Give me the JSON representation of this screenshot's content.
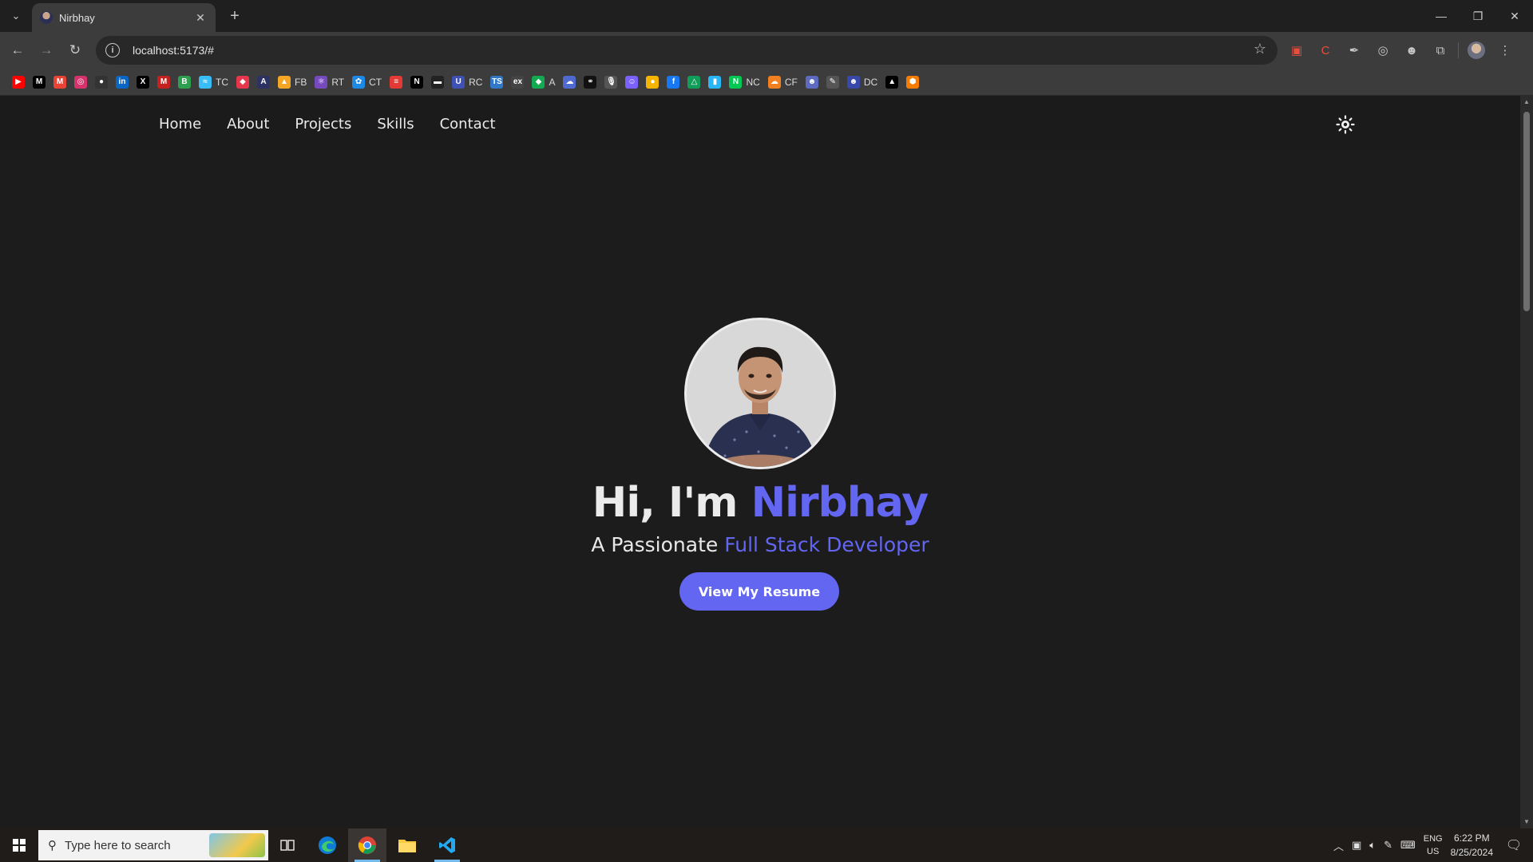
{
  "browser": {
    "tab_title": "Nirbhay",
    "url": "localhost:5173/#",
    "window_controls": {
      "minimize": "—",
      "restore": "❐",
      "close": "✕"
    },
    "bookmarks": [
      {
        "icon": "youtube-icon",
        "label": "",
        "color": "#ff0000",
        "glyph": "▶"
      },
      {
        "icon": "medium-icon",
        "label": "",
        "color": "#000000",
        "glyph": "M"
      },
      {
        "icon": "gmail-icon",
        "label": "",
        "color": "#ea4335",
        "glyph": "M"
      },
      {
        "icon": "chat-icon",
        "label": "",
        "color": "#d6336c",
        "glyph": "◎"
      },
      {
        "icon": "github-icon",
        "label": "",
        "color": "#333333",
        "glyph": "●"
      },
      {
        "icon": "linkedin-icon",
        "label": "",
        "color": "#0a66c2",
        "glyph": "in"
      },
      {
        "icon": "x-icon",
        "label": "",
        "color": "#000000",
        "glyph": "X"
      },
      {
        "icon": "gmail-icon",
        "label": "",
        "color": "#c5221f",
        "glyph": "M"
      },
      {
        "icon": "bootstrap-icon",
        "label": "",
        "color": "#2e9e4f",
        "glyph": "B"
      },
      {
        "icon": "tailwind-icon",
        "label": "TC",
        "color": "#38bdf8",
        "glyph": "≈"
      },
      {
        "icon": "redux-icon",
        "label": "",
        "color": "#e5364b",
        "glyph": "◆"
      },
      {
        "icon": "angular-icon",
        "label": "",
        "color": "#2d3262",
        "glyph": "A"
      },
      {
        "icon": "firebase-icon",
        "label": "FB",
        "color": "#f5a623",
        "glyph": "▲"
      },
      {
        "icon": "redux-toolkit-icon",
        "label": "RT",
        "color": "#764abc",
        "glyph": "⚛"
      },
      {
        "icon": "paw-icon",
        "label": "CT",
        "color": "#1e88e5",
        "glyph": "✿"
      },
      {
        "icon": "stripe-icon",
        "label": "",
        "color": "#e53935",
        "glyph": "≡"
      },
      {
        "icon": "nextjs-icon",
        "label": "",
        "color": "#000000",
        "glyph": "N"
      },
      {
        "icon": "briefcase-icon",
        "label": "",
        "color": "#222222",
        "glyph": "▬"
      },
      {
        "icon": "ui-icon",
        "label": "RC",
        "color": "#3f51b5",
        "glyph": "U"
      },
      {
        "icon": "typescript-icon",
        "label": "",
        "color": "#3178c6",
        "glyph": "TS"
      },
      {
        "icon": "express-icon",
        "label": "",
        "color": "#444444",
        "glyph": "ex"
      },
      {
        "icon": "mongodb-icon",
        "label": "A",
        "color": "#13aa52",
        "glyph": "◆"
      },
      {
        "icon": "cloud-icon",
        "label": "",
        "color": "#4f6bd1",
        "glyph": "☁"
      },
      {
        "icon": "link-icon",
        "label": "",
        "color": "#111111",
        "glyph": "⚭"
      },
      {
        "icon": "mic-icon",
        "label": "",
        "color": "#555555",
        "glyph": "🎙"
      },
      {
        "icon": "avatar-icon",
        "label": "",
        "color": "#7b61ff",
        "glyph": "☺"
      },
      {
        "icon": "person-icon",
        "label": "",
        "color": "#f4b400",
        "glyph": "●"
      },
      {
        "icon": "facebook-icon",
        "label": "",
        "color": "#1877f2",
        "glyph": "f"
      },
      {
        "icon": "google-drive-icon",
        "label": "",
        "color": "#0f9d58",
        "glyph": "△"
      },
      {
        "icon": "file-icon",
        "label": "",
        "color": "#29b6f6",
        "glyph": "▮"
      },
      {
        "icon": "nc-icon",
        "label": "NC",
        "color": "#00c853",
        "glyph": "N"
      },
      {
        "icon": "cloudflare-icon",
        "label": "CF",
        "color": "#f38020",
        "glyph": "☁"
      },
      {
        "icon": "avatar-icon",
        "label": "",
        "color": "#5c6bc0",
        "glyph": "☻"
      },
      {
        "icon": "pen-icon",
        "label": "",
        "color": "#555555",
        "glyph": "✎"
      },
      {
        "icon": "dc-icon",
        "label": "DC",
        "color": "#3949ab",
        "glyph": "☻"
      },
      {
        "icon": "vercel-icon",
        "label": "",
        "color": "#000000",
        "glyph": "▲"
      },
      {
        "icon": "package-icon",
        "label": "",
        "color": "#f57c00",
        "glyph": "⬢"
      }
    ]
  },
  "site": {
    "nav": [
      "Home",
      "About",
      "Projects",
      "Skills",
      "Contact"
    ],
    "hero": {
      "greeting": "Hi, I'm ",
      "name": "Nirbhay",
      "subtitle_prefix": "A Passionate ",
      "subtitle_role": "Full Stack Developer",
      "button": "View My Resume"
    },
    "colors": {
      "accent": "#6366f1",
      "background": "#1c1c1c"
    }
  },
  "taskbar": {
    "search_placeholder": "Type here to search",
    "lang_top": "ENG",
    "lang_bottom": "US",
    "time": "6:22 PM",
    "date": "8/25/2024"
  }
}
